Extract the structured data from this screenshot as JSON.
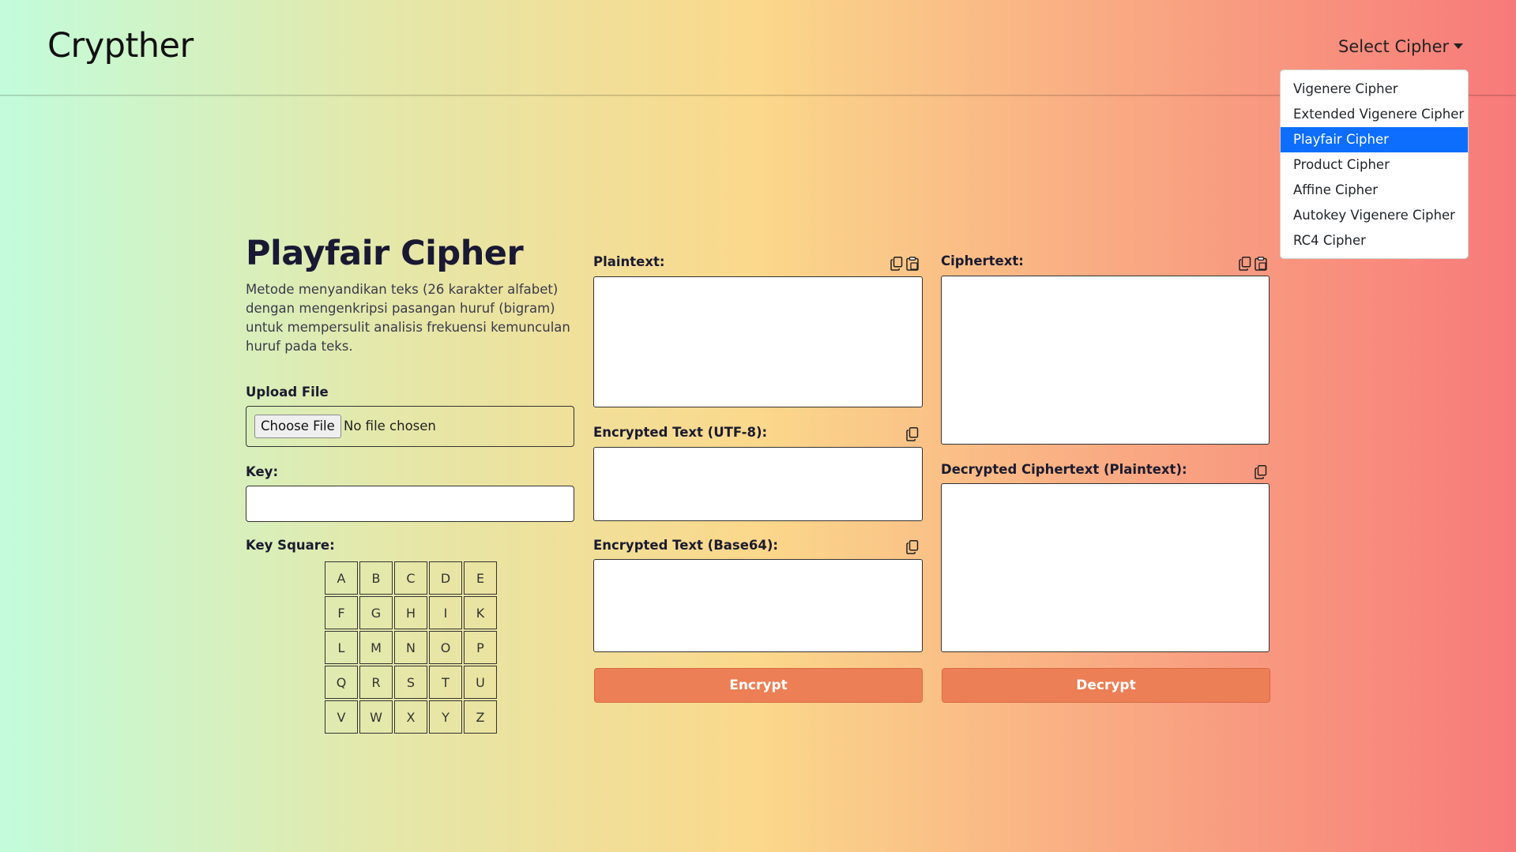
{
  "navbar": {
    "brand": "Crypther",
    "select_label": "Select Cipher",
    "dropdown": [
      {
        "label": "Vigenere Cipher"
      },
      {
        "label": "Extended Vigenere Cipher"
      },
      {
        "label": "Playfair Cipher",
        "active": true
      },
      {
        "label": "Product Cipher"
      },
      {
        "label": "Affine Cipher"
      },
      {
        "label": "Autokey Vigenere Cipher"
      },
      {
        "label": "RC4 Cipher"
      }
    ]
  },
  "page": {
    "title": "Playfair Cipher",
    "description": "Metode menyandikan teks (26 karakter alfabet) dengan mengenkripsi pasangan huruf (bigram) untuk mempersulit analisis frekuensi kemunculan huruf pada teks."
  },
  "upload": {
    "label": "Upload File",
    "button": "Choose File",
    "status": "No file chosen"
  },
  "key": {
    "label": "Key:",
    "value": ""
  },
  "key_square": {
    "label": "Key Square:",
    "letters": [
      "A",
      "B",
      "C",
      "D",
      "E",
      "F",
      "G",
      "H",
      "I",
      "K",
      "L",
      "M",
      "N",
      "O",
      "P",
      "Q",
      "R",
      "S",
      "T",
      "U",
      "V",
      "W",
      "X",
      "Y",
      "Z"
    ]
  },
  "plaintext": {
    "label": "Plaintext:",
    "value": ""
  },
  "encrypted_utf8": {
    "label": "Encrypted Text (UTF-8):",
    "value": ""
  },
  "encrypted_base64": {
    "label": "Encrypted Text (Base64):",
    "value": ""
  },
  "ciphertext": {
    "label": "Ciphertext:",
    "value": ""
  },
  "decrypted": {
    "label": "Decrypted Ciphertext (Plaintext):",
    "value": ""
  },
  "buttons": {
    "encrypt": "Encrypt",
    "decrypt": "Decrypt"
  },
  "colors": {
    "accent_button": "#ec7f55",
    "dropdown_active": "#0d6efd"
  },
  "icons": {
    "copy": "copy-icon",
    "paste": "paste-icon",
    "caret": "caret-down-icon"
  }
}
